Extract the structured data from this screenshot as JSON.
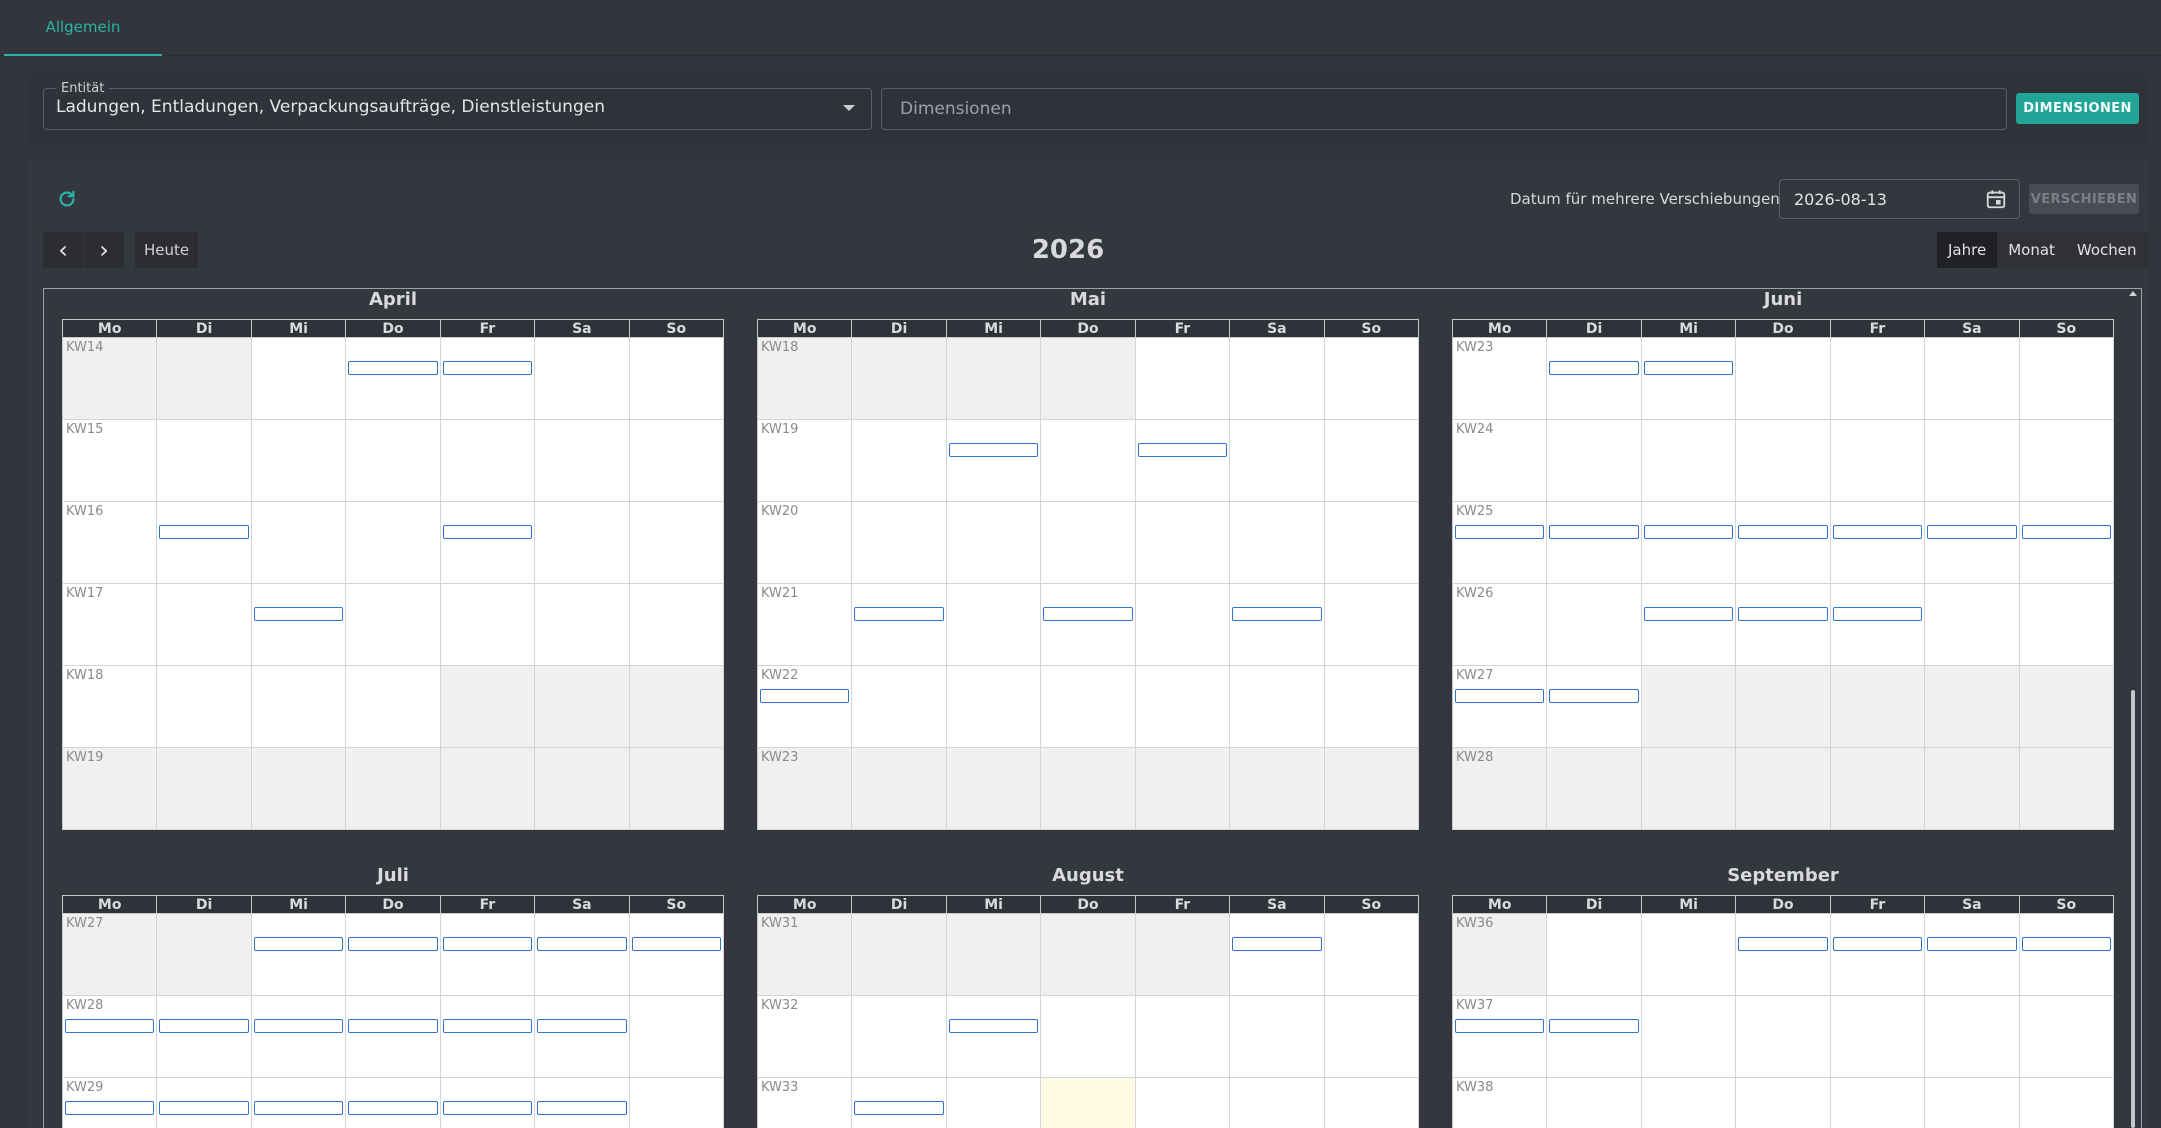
{
  "tabs": [
    {
      "label": "Allgemein",
      "active": true
    }
  ],
  "filters": {
    "entity_label": "Entität",
    "entity_value": "Ladungen, Entladungen, Verpackungsaufträge, Dienstleistungen",
    "dimensions_placeholder": "Dimensionen",
    "dimensions_button": "DIMENSIONEN"
  },
  "toolbar": {
    "refresh_icon": "refresh-icon",
    "date_label": "Datum für mehrere Verschiebungen",
    "date_value": "2026-08-13",
    "shift_button": "VERSCHIEBEN",
    "prev_icon": "chevron-left-icon",
    "next_icon": "chevron-right-icon",
    "prev_glyph": "‹",
    "next_glyph": "›",
    "today_button": "Heute",
    "year_title": "2026",
    "views": [
      {
        "label": "Jahre",
        "active": true
      },
      {
        "label": "Monat",
        "active": false
      },
      {
        "label": "Wochen",
        "active": false
      }
    ]
  },
  "colors": {
    "accent": "#22a597",
    "event_border": "#2f74d0",
    "outside_day": "#f0f0f0",
    "today": "#fef9e3"
  },
  "weekdays": [
    "Mo",
    "Di",
    "Mi",
    "Do",
    "Fr",
    "Sa",
    "So"
  ],
  "months": [
    {
      "name": "April",
      "weeks": [
        {
          "kw": "KW14",
          "out": [
            0,
            1
          ],
          "events": [
            3,
            4
          ]
        },
        {
          "kw": "KW15",
          "out": [],
          "events": []
        },
        {
          "kw": "KW16",
          "out": [],
          "events": [
            1,
            4
          ]
        },
        {
          "kw": "KW17",
          "out": [],
          "events": [
            2
          ]
        },
        {
          "kw": "KW18",
          "out": [
            4,
            5,
            6
          ],
          "events": []
        },
        {
          "kw": "KW19",
          "out": [
            0,
            1,
            2,
            3,
            4,
            5,
            6
          ],
          "events": []
        }
      ]
    },
    {
      "name": "Mai",
      "weeks": [
        {
          "kw": "KW18",
          "out": [
            0,
            1,
            2,
            3
          ],
          "events": []
        },
        {
          "kw": "KW19",
          "out": [],
          "events": [
            2,
            4
          ]
        },
        {
          "kw": "KW20",
          "out": [],
          "events": []
        },
        {
          "kw": "KW21",
          "out": [],
          "events": [
            1,
            3,
            5
          ]
        },
        {
          "kw": "KW22",
          "out": [],
          "events": [
            0
          ]
        },
        {
          "kw": "KW23",
          "out": [
            0,
            1,
            2,
            3,
            4,
            5,
            6
          ],
          "events": []
        }
      ]
    },
    {
      "name": "Juni",
      "weeks": [
        {
          "kw": "KW23",
          "out": [],
          "events": [
            1,
            2
          ]
        },
        {
          "kw": "KW24",
          "out": [],
          "events": []
        },
        {
          "kw": "KW25",
          "out": [],
          "events": [
            0,
            1,
            2,
            3,
            4,
            5,
            6
          ]
        },
        {
          "kw": "KW26",
          "out": [],
          "events": [
            2,
            3,
            4
          ]
        },
        {
          "kw": "KW27",
          "out": [
            2,
            3,
            4,
            5,
            6
          ],
          "events": [
            0,
            1
          ]
        },
        {
          "kw": "KW28",
          "out": [
            0,
            1,
            2,
            3,
            4,
            5,
            6
          ],
          "events": []
        }
      ]
    },
    {
      "name": "Juli",
      "weeks": [
        {
          "kw": "KW27",
          "out": [
            0,
            1
          ],
          "events": [
            2,
            3,
            4,
            5,
            6
          ]
        },
        {
          "kw": "KW28",
          "out": [],
          "events": [
            0,
            1,
            2,
            3,
            4,
            5
          ]
        },
        {
          "kw": "KW29",
          "out": [],
          "events": [
            0,
            1,
            2,
            3,
            4,
            5
          ]
        }
      ]
    },
    {
      "name": "August",
      "weeks": [
        {
          "kw": "KW31",
          "out": [
            0,
            1,
            2,
            3,
            4
          ],
          "events": [
            5
          ]
        },
        {
          "kw": "KW32",
          "out": [],
          "events": [
            2
          ]
        },
        {
          "kw": "KW33",
          "out": [],
          "today": 3,
          "events": [
            1
          ]
        }
      ]
    },
    {
      "name": "September",
      "weeks": [
        {
          "kw": "KW36",
          "out": [
            0
          ],
          "events": [
            3,
            4,
            5,
            6
          ]
        },
        {
          "kw": "KW37",
          "out": [],
          "events": [
            0,
            1
          ]
        },
        {
          "kw": "KW38",
          "out": [],
          "events": []
        }
      ]
    }
  ]
}
